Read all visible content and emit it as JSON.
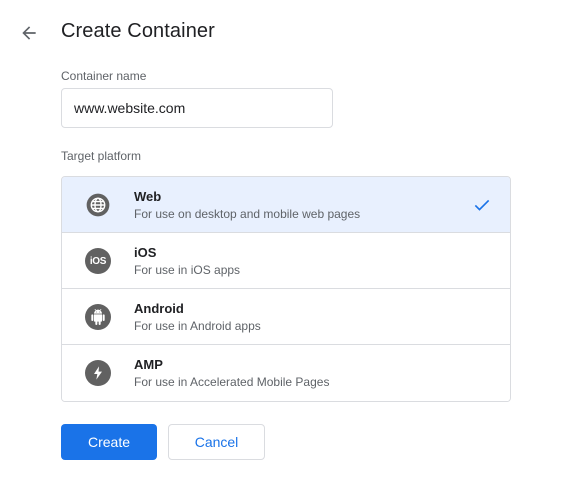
{
  "header": {
    "title": "Create Container",
    "back_icon": "arrow-back-icon"
  },
  "container_name": {
    "label": "Container name",
    "value": "www.website.com"
  },
  "target_platform": {
    "label": "Target platform",
    "selected": "Web",
    "options": [
      {
        "name": "Web",
        "description": "For use on desktop and mobile web pages",
        "icon": "globe-icon"
      },
      {
        "name": "iOS",
        "description": "For use in iOS apps",
        "icon": "ios-icon",
        "icon_text": "iOS"
      },
      {
        "name": "Android",
        "description": "For use in Android apps",
        "icon": "android-icon"
      },
      {
        "name": "AMP",
        "description": "For use in Accelerated Mobile Pages",
        "icon": "amp-bolt-icon"
      }
    ]
  },
  "actions": {
    "create_label": "Create",
    "cancel_label": "Cancel"
  },
  "colors": {
    "accent": "#1a73e8",
    "selected_bg": "#e8f0fe",
    "icon_gray": "#616161",
    "border": "#dadce0"
  }
}
